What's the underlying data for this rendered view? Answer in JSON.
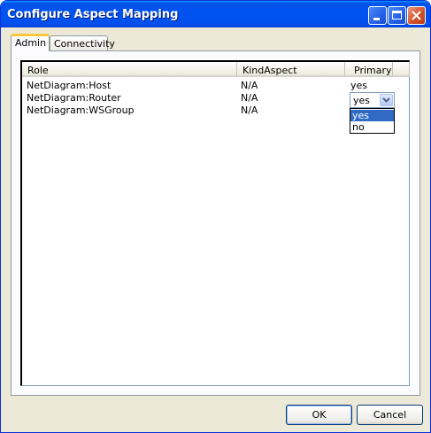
{
  "window": {
    "title": "Configure Aspect Mapping",
    "controls": [
      "minimize-icon",
      "maximize-icon",
      "close-icon"
    ]
  },
  "tabs": [
    {
      "label": "Admin",
      "active": true
    },
    {
      "label": "Connectivity",
      "active": false
    }
  ],
  "table": {
    "columns": [
      "Role",
      "KindAspect",
      "Primary"
    ],
    "rows": [
      {
        "role": "NetDiagram:Host",
        "kind": "N/A",
        "primary": "yes"
      },
      {
        "role": "NetDiagram:Router",
        "kind": "N/A",
        "primary": "yes"
      },
      {
        "role": "NetDiagram:WSGroup",
        "kind": "N/A",
        "primary": ""
      }
    ]
  },
  "primary_dropdown": {
    "selected": "yes",
    "options": [
      "yes",
      "no"
    ],
    "highlighted": "yes"
  },
  "buttons": {
    "ok": "OK",
    "cancel": "Cancel"
  },
  "colors": {
    "titlebar": "#0054e3",
    "selection": "#316ac5",
    "face": "#ece9d8"
  }
}
